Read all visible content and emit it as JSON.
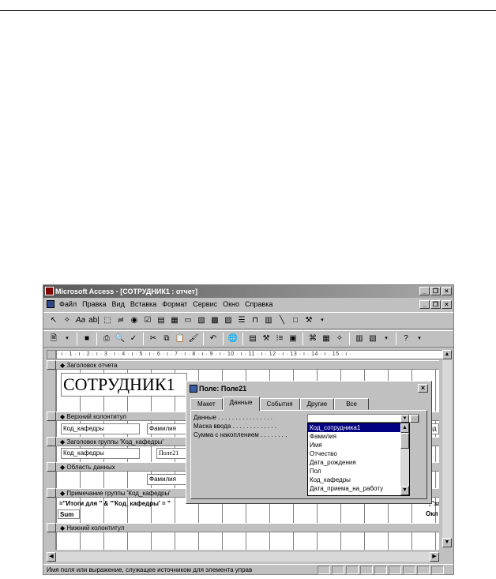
{
  "window": {
    "title": "Microsoft Access - [СОТРУДНИК1 : отчет]"
  },
  "menu": [
    "Файл",
    "Правка",
    "Вид",
    "Вставка",
    "Формат",
    "Сервис",
    "Окно",
    "Справка"
  ],
  "ruler_text": "· ı · 1 · ı · 2 · ı · 3 · ı · 4 · ı · 5 · ı · 6 · ı · 7 · ı · 8 · ı · 9 · ı · 10 · ı · 11 · ı · 12 · ı · 13 · ı · 14 · ı · 15 · ı ·",
  "bands": {
    "report_header": "Заголовок отчета",
    "page_header": "Верхний колонтитул",
    "group_header": "Заголовок группы 'Код_кафедры'",
    "detail": "Область данных",
    "group_footer": "Примечание группы 'Код_кафедры'",
    "page_footer": "Нижний колонтитул"
  },
  "controls": {
    "report_title": "СОТРУДНИК1",
    "ph_kod_kafedry": "Код_кафедры",
    "ph_familiya": "Фамилия",
    "ph_right": "кпд",
    "gh_kod_kafedry": "Код_кафедры",
    "gh_pole21": "Поле21",
    "detail_familiya": "Фамилия",
    "gf_expression": "=\"Итоги для \" & \"'Код_кафедры' = \"",
    "gf_sum": "Sum",
    "gf_right1": "\";\"за",
    "gf_right2": "Окл"
  },
  "dialog": {
    "title": "Поле: Поле21",
    "tabs": [
      "Макет",
      "Данные",
      "События",
      "Другие",
      "Все"
    ],
    "active_tab": "Данные",
    "properties": [
      "Данные . . . . . . . . . . . . . . . .",
      "Маска ввода . . . . . . . . . . . . .",
      "Сумма с накоплением . . . . . . . ."
    ],
    "combo_value": "",
    "list_items": [
      "Код_сотрудника1",
      "Фамилия",
      "Имя",
      "Отчество",
      "Дата_рождения",
      "Пол",
      "Код_кафедры",
      "Дата_приема_на_работу"
    ],
    "selected_item": "Код_сотрудника1"
  },
  "status_text": "Имя поля или выражение, служащее источником для элемента управ"
}
